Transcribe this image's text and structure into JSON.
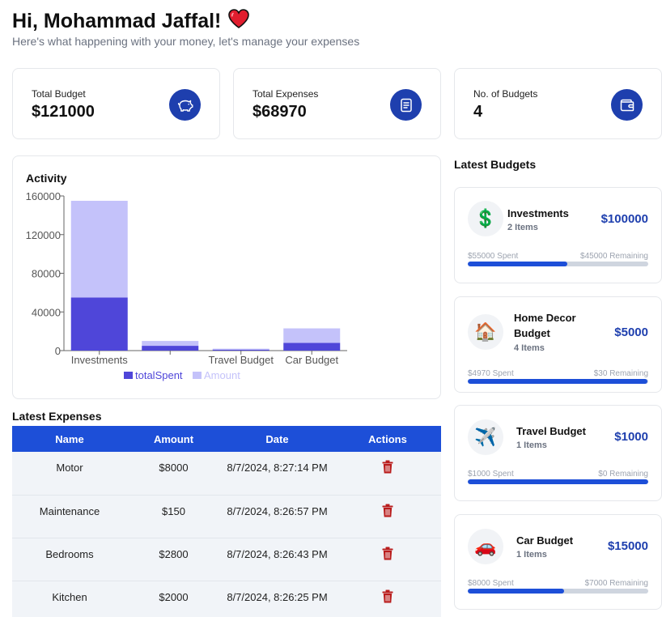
{
  "header": {
    "greeting": "Hi, Mohammad Jaffal!",
    "subtitle": "Here's what happening with your money, let's manage your expenses"
  },
  "stats": [
    {
      "label": "Total Budget",
      "value": "$121000",
      "icon": "piggy-bank-icon"
    },
    {
      "label": "Total Expenses",
      "value": "$68970",
      "icon": "receipt-icon"
    },
    {
      "label": "No. of Budgets",
      "value": "4",
      "icon": "wallet-icon"
    }
  ],
  "activity": {
    "title": "Activity",
    "chart_data": {
      "type": "bar",
      "stacked": true,
      "categories": [
        "Investments",
        "Home Decor Budget",
        "Travel Budget",
        "Car Budget"
      ],
      "visible_tick_labels": [
        "Investments",
        "",
        "Travel Budget",
        "Car Budget"
      ],
      "series": [
        {
          "name": "totalSpent",
          "values": [
            55000,
            4970,
            1000,
            8000
          ],
          "color": "#4f46d9"
        },
        {
          "name": "Amount",
          "values": [
            100000,
            5000,
            1000,
            15000
          ],
          "color": "#c4c2fa"
        }
      ],
      "yticks": [
        "0",
        "40000",
        "80000",
        "120000",
        "160000"
      ],
      "ylim": [
        0,
        160000
      ],
      "legend": "bottom",
      "grid": false
    }
  },
  "expenses": {
    "title": "Latest Expenses",
    "columns": [
      "Name",
      "Amount",
      "Date",
      "Actions"
    ],
    "rows": [
      {
        "name": "Motor",
        "amount": "$8000",
        "date": "8/7/2024, 8:27:14 PM"
      },
      {
        "name": "Maintenance",
        "amount": "$150",
        "date": "8/7/2024, 8:26:57 PM"
      },
      {
        "name": "Bedrooms",
        "amount": "$2800",
        "date": "8/7/2024, 8:26:43 PM"
      },
      {
        "name": "Kitchen",
        "amount": "$2000",
        "date": "8/7/2024, 8:26:25 PM"
      }
    ],
    "action_icon": "trash-icon"
  },
  "budgets": {
    "title": "Latest Budgets",
    "items": [
      {
        "emoji": "💲",
        "name": "Investments",
        "items": "2 Items",
        "amount": "$100000",
        "spent": "$55000 Spent",
        "remaining": "$45000 Remaining",
        "progress": 0.55
      },
      {
        "emoji": "🏠",
        "name": "Home Decor Budget",
        "items": "4 Items",
        "amount": "$5000",
        "spent": "$4970 Spent",
        "remaining": "$30 Remaining",
        "progress": 0.994
      },
      {
        "emoji": "✈️",
        "name": "Travel Budget",
        "items": "1 Items",
        "amount": "$1000",
        "spent": "$1000 Spent",
        "remaining": "$0 Remaining",
        "progress": 1.0
      },
      {
        "emoji": "🚗",
        "name": "Car Budget",
        "items": "1 Items",
        "amount": "$15000",
        "spent": "$8000 Spent",
        "remaining": "$7000 Remaining",
        "progress": 0.533
      }
    ]
  },
  "colors": {
    "primary": "#1d4fd8",
    "icon_circle": "#1e3fae",
    "spent_bar": "#4f46d9",
    "amount_bar": "#c4c2fa",
    "heart": "#e11d2e",
    "trash": "#b91c1c"
  }
}
